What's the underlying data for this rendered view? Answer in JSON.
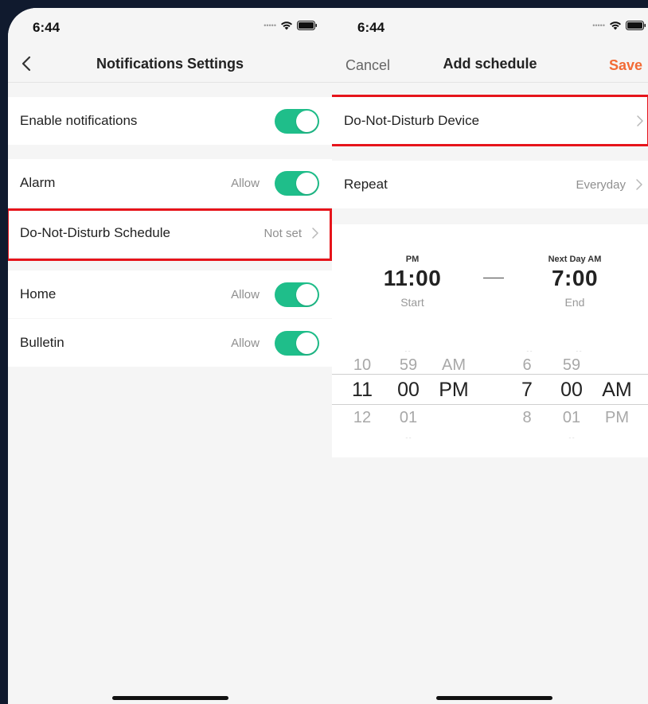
{
  "left": {
    "status_time": "6:44",
    "title": "Notifications Settings",
    "rows": {
      "enable": {
        "label": "Enable notifications",
        "on": true
      },
      "alarm": {
        "label": "Alarm",
        "value": "Allow",
        "on": true
      },
      "dnd": {
        "label": "Do-Not-Disturb Schedule",
        "value": "Not set"
      },
      "home": {
        "label": "Home",
        "value": "Allow",
        "on": true
      },
      "bulletin": {
        "label": "Bulletin",
        "value": "Allow",
        "on": true
      }
    }
  },
  "right": {
    "status_time": "6:44",
    "cancel_label": "Cancel",
    "title": "Add schedule",
    "save_label": "Save",
    "rows": {
      "device": {
        "label": "Do-Not-Disturb Device"
      },
      "repeat": {
        "label": "Repeat",
        "value": "Everyday"
      }
    },
    "start": {
      "caption": "PM",
      "time": "11:00",
      "label": "Start"
    },
    "end": {
      "caption": "Next Day AM",
      "time": "7:00",
      "label": "End"
    },
    "picker": {
      "start_hour": {
        "prev": "10",
        "selected": "11",
        "next": "12"
      },
      "start_minute": {
        "prev": "59",
        "selected": "00",
        "next": "01"
      },
      "start_period": {
        "prev": "AM",
        "selected": "PM"
      },
      "end_hour": {
        "prev": "6",
        "selected": "7",
        "next": "8"
      },
      "end_minute": {
        "prev": "59",
        "selected": "00",
        "next": "01"
      },
      "end_period": {
        "selected": "AM",
        "next": "PM"
      }
    }
  },
  "colors": {
    "toggle_on": "#1fbe8a",
    "save_accent": "#f26a35",
    "highlight_box": "#e6141b",
    "background": "#101a2e"
  },
  "icons": [
    "back-chevron-icon",
    "chevron-right-icon",
    "wifi-icon",
    "battery-icon",
    "signal-icon"
  ]
}
